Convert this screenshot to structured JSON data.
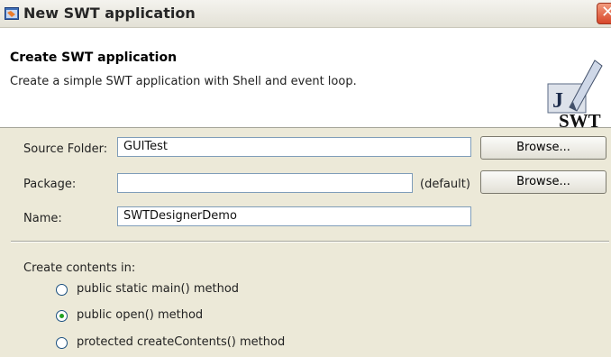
{
  "window": {
    "title": "New SWT application"
  },
  "header": {
    "title": "Create SWT application",
    "description": "Create a simple SWT application with Shell and event loop.",
    "logo": "SWT"
  },
  "form": {
    "source_folder_label": "Source Folder:",
    "source_folder_value": "GUITest",
    "package_label": "Package:",
    "package_value": "",
    "package_default": "(default)",
    "name_label": "Name:",
    "name_value": "SWTDesignerDemo",
    "browse_label": "Browse...",
    "browse2_label": "Browse..."
  },
  "contents": {
    "label": "Create contents in:",
    "options": [
      {
        "label": "public static main() method",
        "selected": false
      },
      {
        "label": "public open() method",
        "selected": true
      },
      {
        "label": "protected createContents() method",
        "selected": false
      }
    ]
  },
  "colors": {
    "radio_dot": "#21a121",
    "header_bg": "#ffffff",
    "dialog_bg": "#ece9d8"
  }
}
